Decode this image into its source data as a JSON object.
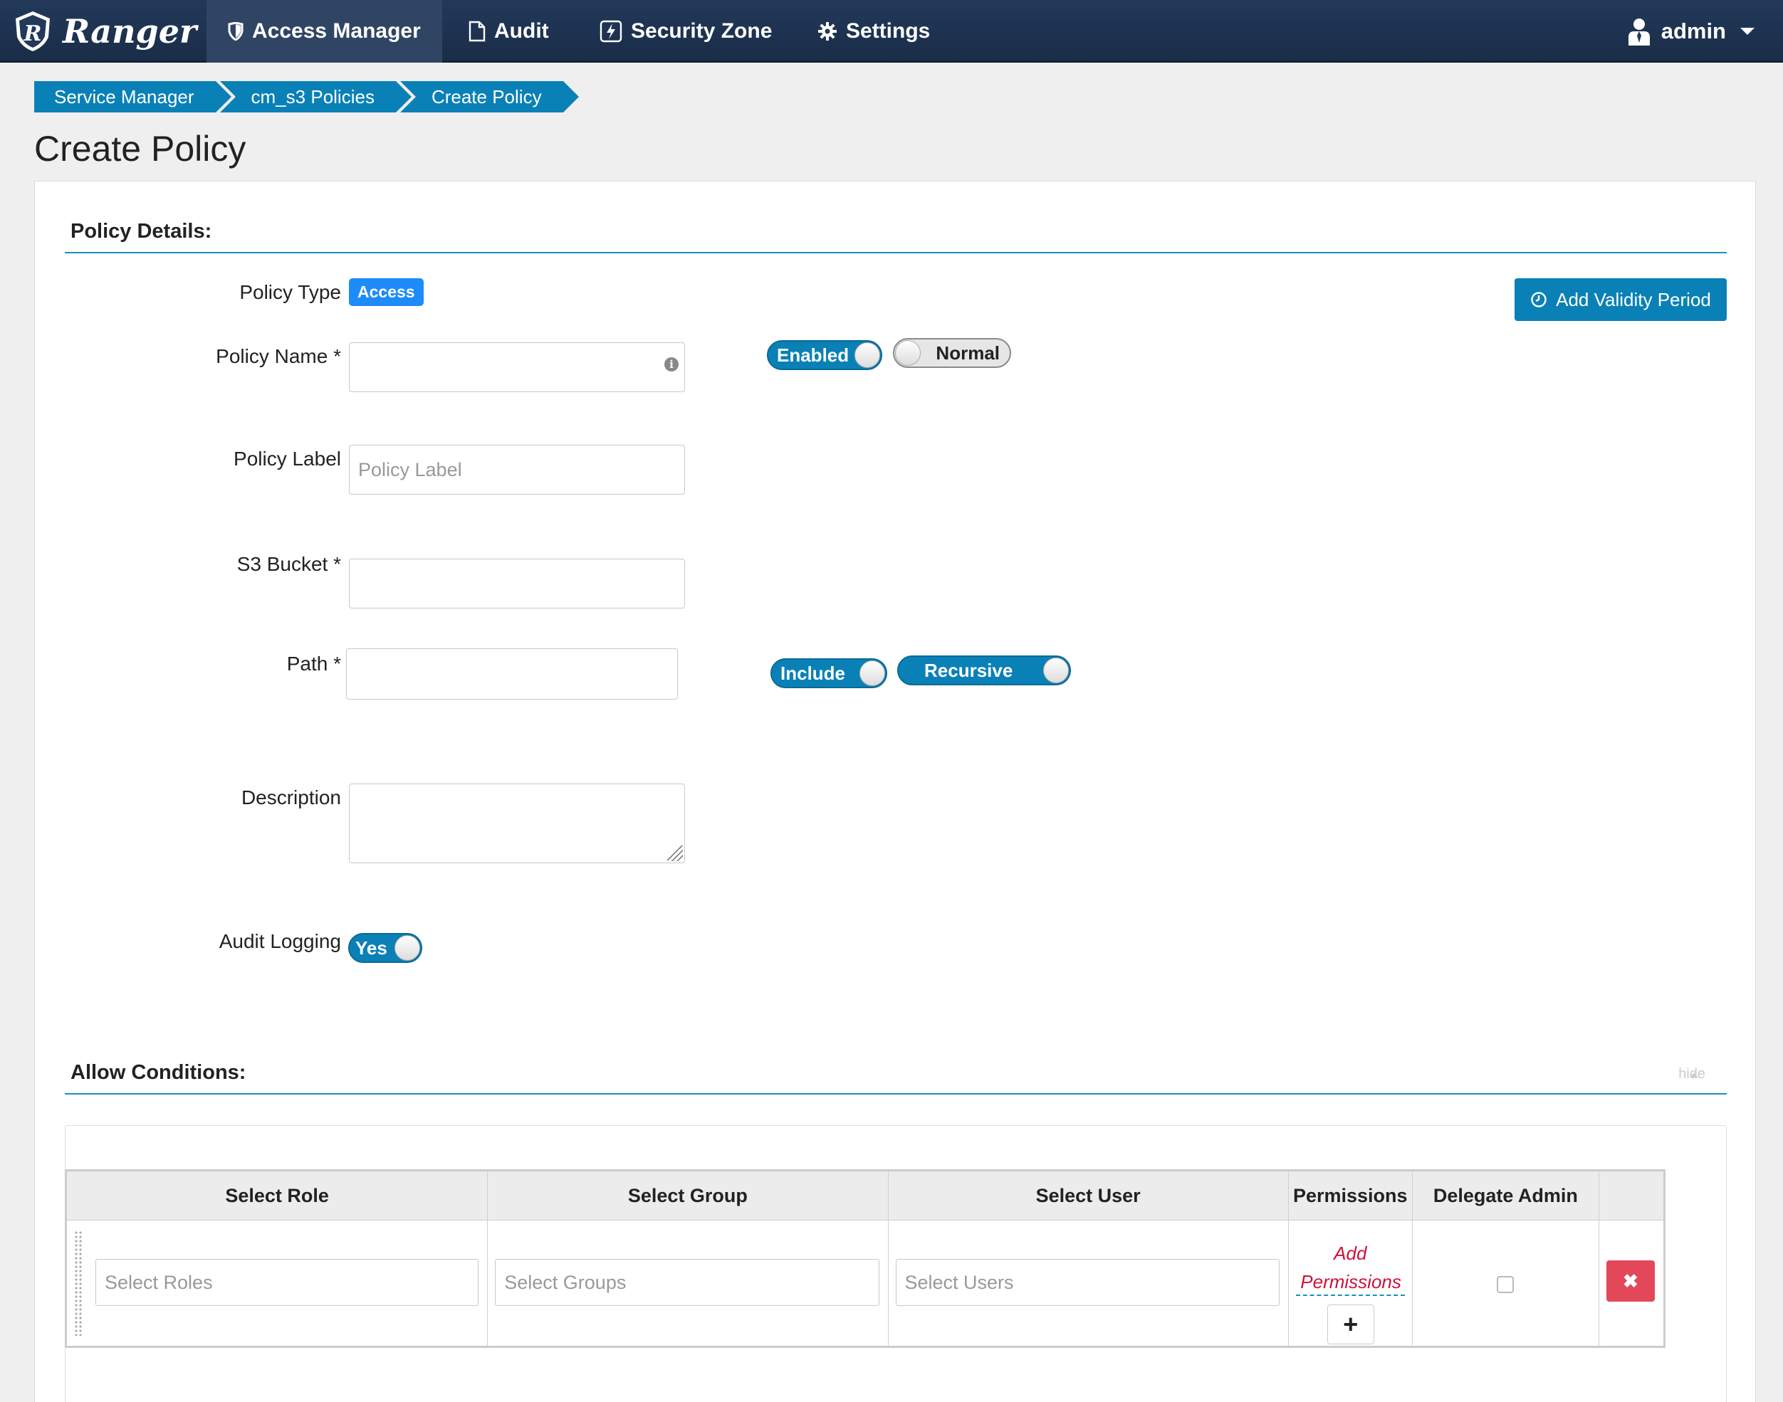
{
  "navbar": {
    "brand": "Ranger",
    "items": [
      {
        "label": "Access Manager",
        "icon": "shield-icon"
      },
      {
        "label": "Audit",
        "icon": "file-icon"
      },
      {
        "label": "Security Zone",
        "icon": "zone-bolt-icon"
      },
      {
        "label": "Settings",
        "icon": "gear-icon"
      }
    ],
    "user": "admin"
  },
  "breadcrumb": [
    "Service Manager",
    "cm_s3 Policies",
    "Create Policy"
  ],
  "page_title": "Create Policy",
  "policy_details": {
    "heading": "Policy Details:",
    "policy_type_label": "Policy Type",
    "policy_type_badge": "Access",
    "add_validity_button": "Add Validity Period",
    "policy_name_label": "Policy Name *",
    "policy_name_value": "",
    "enabled_toggle": "Enabled",
    "normal_toggle": "Normal",
    "policy_label_label": "Policy Label",
    "policy_label_placeholder": "Policy Label",
    "s3_bucket_label": "S3 Bucket *",
    "path_label": "Path *",
    "include_toggle": "Include",
    "recursive_toggle": "Recursive",
    "description_label": "Description",
    "audit_logging_label": "Audit Logging",
    "audit_toggle": "Yes"
  },
  "allow_conditions": {
    "heading": "Allow Conditions:",
    "hide_link": "hide",
    "columns": [
      "Select Role",
      "Select Group",
      "Select User",
      "Permissions",
      "Delegate Admin",
      ""
    ],
    "row": {
      "roles_placeholder": "Select Roles",
      "groups_placeholder": "Select Groups",
      "users_placeholder": "Select Users",
      "add_permissions": "Add Permissions",
      "plus": "+",
      "delete": "✖"
    }
  },
  "colors": {
    "navbar": "#22395a",
    "accent": "#0a81b6",
    "badge": "#1d8cf8",
    "danger": "#e3485a",
    "link_red": "#d0103a"
  }
}
